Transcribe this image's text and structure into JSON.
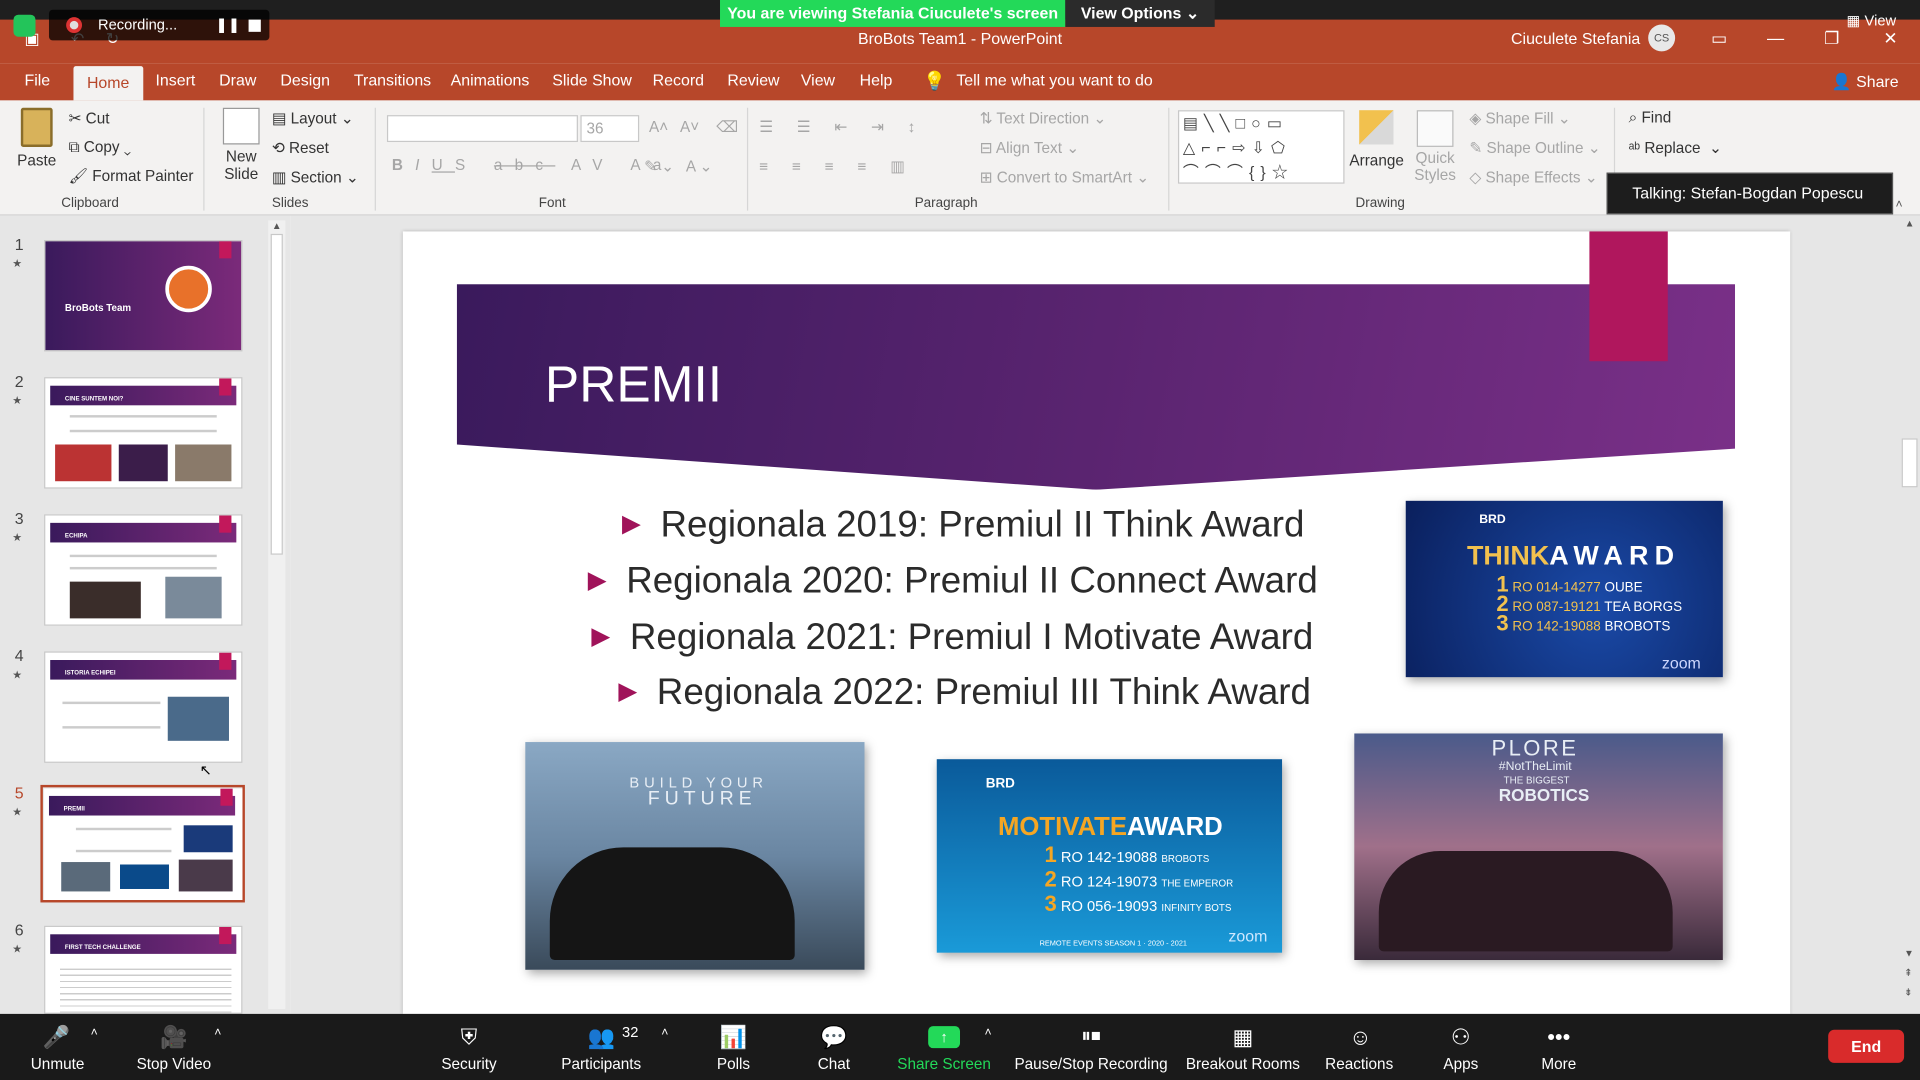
{
  "zoom": {
    "banner": "You are viewing Stefania Ciuculete's screen",
    "view_options": "View Options",
    "recording": "Recording...",
    "view": "View",
    "talking": "Talking: Stefan-Bogdan Popescu",
    "participants_count": "32",
    "buttons": [
      "Unmute",
      "Stop Video",
      "Security",
      "Participants",
      "Polls",
      "Chat",
      "Share Screen",
      "Pause/Stop Recording",
      "Breakout Rooms",
      "Reactions",
      "Apps",
      "More"
    ],
    "end": "End"
  },
  "ppt": {
    "title": "BroBots Team1  -  PowerPoint",
    "user": "Ciuculete Stefania",
    "initials": "CS",
    "tabs": [
      "File",
      "Home",
      "Insert",
      "Draw",
      "Design",
      "Transitions",
      "Animations",
      "Slide Show",
      "Record",
      "Review",
      "View",
      "Help"
    ],
    "tell_me": "Tell me what you want to do",
    "share": "Share",
    "ribbon": {
      "paste": "Paste",
      "cut": "Cut",
      "copy": "Copy",
      "format_painter": "Format Painter",
      "clipboard": "Clipboard",
      "new_slide_1": "New",
      "new_slide_2": "Slide",
      "layout": "Layout",
      "reset": "Reset",
      "section": "Section",
      "slides": "Slides",
      "font_size": "36",
      "font": "Font",
      "text_direction": "Text Direction",
      "align_text": "Align Text",
      "convert_smartart": "Convert to SmartArt",
      "paragraph": "Paragraph",
      "arrange": "Arrange",
      "quick_styles_1": "Quick",
      "quick_styles_2": "Styles",
      "shape_fill": "Shape Fill",
      "shape_outline": "Shape Outline",
      "shape_effects": "Shape Effects",
      "drawing": "Drawing",
      "find": "Find",
      "replace": "Replace"
    }
  },
  "thumbs": [
    {
      "num": "1",
      "title": "BroBots Team"
    },
    {
      "num": "2",
      "title": "CINE SUNTEM NOI?"
    },
    {
      "num": "3",
      "title": "ECHIPA"
    },
    {
      "num": "4",
      "title": "ISTORIA ECHIPEI"
    },
    {
      "num": "5",
      "title": "PREMII"
    },
    {
      "num": "6",
      "title": "FIRST TECH CHALLENGE"
    }
  ],
  "slide": {
    "title": "PREMII",
    "bullets": [
      "Regionala 2019: Premiul II Think Award",
      "Regionala 2020: Premiul II Connect Award",
      "Regionala 2021: Premiul I Motivate Award",
      "Regionala 2022: Premiul III Think Award"
    ],
    "think_award": {
      "brand": "BRD",
      "title_a": "THINK",
      "title_b": "AWARD",
      "rows": [
        {
          "rank": "1",
          "code": "RO 014-14277",
          "team": "OUBE"
        },
        {
          "rank": "2",
          "code": "RO 087-19121",
          "team": "TEA BORGS"
        },
        {
          "rank": "3",
          "code": "RO 142-19088",
          "team": "BROBOTS"
        }
      ],
      "zoom": "zoom"
    },
    "motivate_award": {
      "brand": "BRD",
      "title_a": "MOTIVATE",
      "title_b": "AWARD",
      "rows": [
        {
          "rank": "1",
          "code": "RO 142-19088",
          "team": "BROBOTS"
        },
        {
          "rank": "2",
          "code": "RO 124-19073",
          "team": "THE EMPEROR"
        },
        {
          "rank": "3",
          "code": "RO 056-19093",
          "team": "INFINITY BOTS"
        }
      ],
      "footer": "REMOTE EVENTS SEASON 1 · 2020 - 2021",
      "zoom": "zoom"
    },
    "photo1_text": [
      "BUILD YOUR",
      "FUTURE"
    ],
    "photo3_text": [
      "PLORE",
      "#NotTheLimit",
      "THE BIGGEST",
      "ROBOTICS"
    ]
  }
}
